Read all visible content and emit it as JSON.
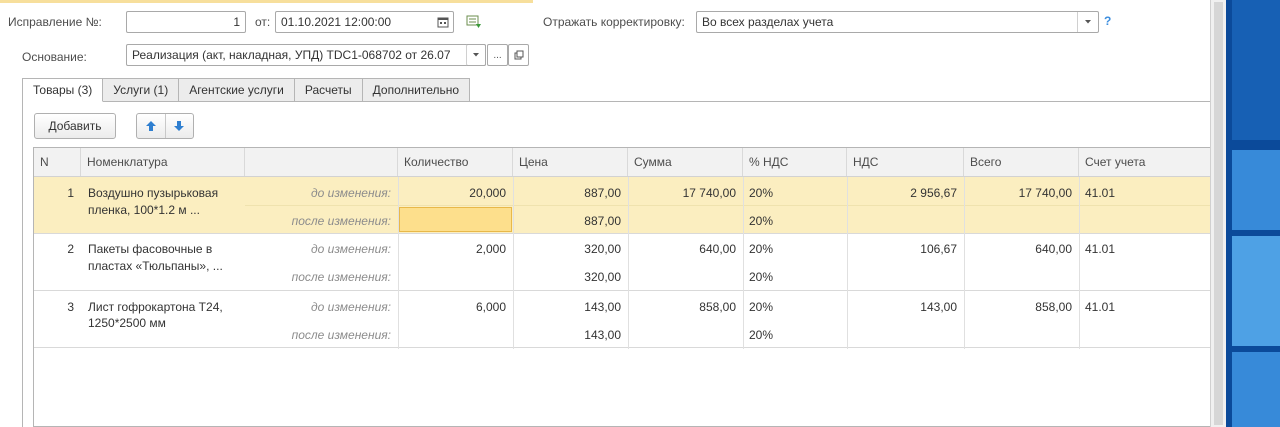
{
  "header": {
    "correction_label": "Исправление №:",
    "correction_value": "1",
    "from_label": "от:",
    "date_value": "01.10.2021 12:00:00",
    "reflect_label": "Отражать корректировку:",
    "reflect_value": "Во всех разделах учета",
    "help": "?",
    "basis_label": "Основание:",
    "basis_value": "Реализация (акт, накладная, УПД) TDC1-068702 от 26.07",
    "basis_more": "..."
  },
  "tabs": [
    {
      "label": "Товары (3)",
      "active": true
    },
    {
      "label": "Услуги (1)",
      "active": false
    },
    {
      "label": "Агентские услуги",
      "active": false
    },
    {
      "label": "Расчеты",
      "active": false
    },
    {
      "label": "Дополнительно",
      "active": false
    }
  ],
  "toolbar": {
    "add_label": "Добавить",
    "up_icon": "arrow-up-icon",
    "down_icon": "arrow-down-icon"
  },
  "table": {
    "columns": [
      "N",
      "Номенклатура",
      "",
      "Количество",
      "Цена",
      "Сумма",
      "% НДС",
      "НДС",
      "Всего",
      "Счет учета"
    ],
    "rows": [
      {
        "n": "1",
        "name_line1": "Воздушно пузырьковая",
        "name_line2": "пленка, 100*1.2 м ...",
        "before_label": "до изменения:",
        "after_label": "после изменения:",
        "before": {
          "qty": "20,000",
          "price": "887,00",
          "sum": "17 740,00",
          "vat_rate": "20%",
          "vat": "2 956,67",
          "total": "17 740,00",
          "account": "41.01"
        },
        "after": {
          "qty": "",
          "price": "887,00",
          "sum": "",
          "vat_rate": "20%",
          "vat": "",
          "total": "",
          "account": ""
        }
      },
      {
        "n": "2",
        "name_line1": "Пакеты фасовочные в",
        "name_line2": "пластах «Тюльпаны», ...",
        "before_label": "до изменения:",
        "after_label": "после изменения:",
        "before": {
          "qty": "2,000",
          "price": "320,00",
          "sum": "640,00",
          "vat_rate": "20%",
          "vat": "106,67",
          "total": "640,00",
          "account": "41.01"
        },
        "after": {
          "qty": "",
          "price": "320,00",
          "sum": "",
          "vat_rate": "20%",
          "vat": "",
          "total": "",
          "account": ""
        }
      },
      {
        "n": "3",
        "name_line1": "Лист гофрокартона Т24,",
        "name_line2": "1250*2500 мм",
        "before_label": "до изменения:",
        "after_label": "после изменения:",
        "before": {
          "qty": "6,000",
          "price": "143,00",
          "sum": "858,00",
          "vat_rate": "20%",
          "vat": "143,00",
          "total": "858,00",
          "account": "41.01"
        },
        "after": {
          "qty": "",
          "price": "143,00",
          "sum": "",
          "vat_rate": "20%",
          "vat": "",
          "total": "",
          "account": ""
        }
      }
    ]
  },
  "colors": {
    "selected_row": "#fbeec0",
    "edit_cell": "#fddf8c",
    "help": "#3d8ede",
    "desktop": "#0b4a9a"
  }
}
